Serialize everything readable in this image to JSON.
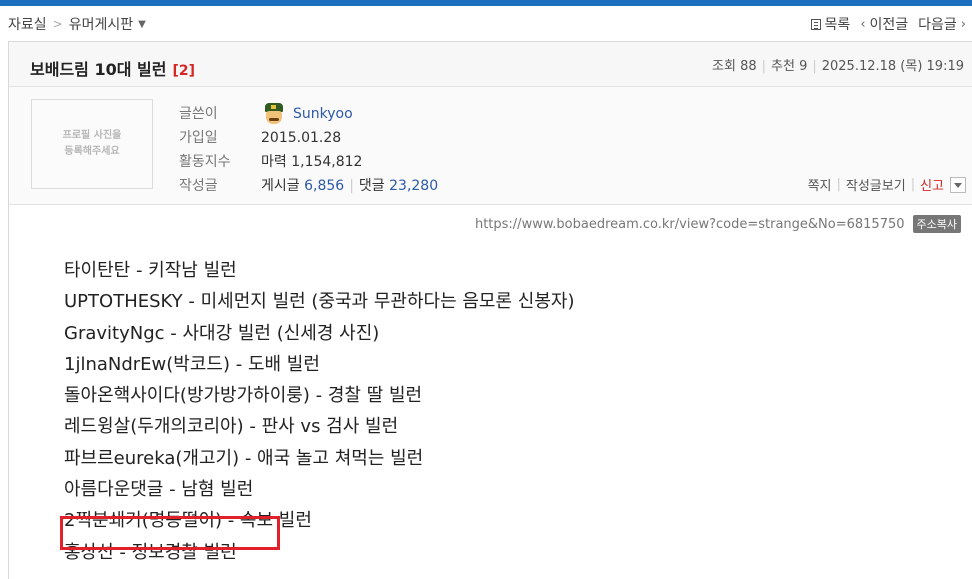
{
  "breadcrumb": {
    "section": "자료실",
    "separator": ">",
    "board": "유머게시판"
  },
  "nav": {
    "list_label": "목록",
    "prev_label": "이전글",
    "next_label": "다음글"
  },
  "post": {
    "title": "보배드림 10대 빌런",
    "comment_count": "[2]",
    "views_label": "조회",
    "views": "88",
    "recommend_label": "추천",
    "recommend": "9",
    "date": "2025.12.18 (목) 19:19"
  },
  "author": {
    "photo_placeholder": "프로필 사진을\n등록해주세요",
    "labels": {
      "writer": "글쓴이",
      "joined": "가입일",
      "activity": "활동지수",
      "posts": "작성글"
    },
    "nickname": "Sunkyoo",
    "joined_date": "2015.01.28",
    "activity_value": "마력 1,154,812",
    "posts_label": "게시글",
    "posts_count": "6,856",
    "comments_label": "댓글",
    "comments_count": "23,280",
    "avatar_icon": "soldier-avatar-icon"
  },
  "tools": {
    "message": "쪽지",
    "view_posts": "작성글보기",
    "report": "신고"
  },
  "url": {
    "text": "https://www.bobaedream.co.kr/view?code=strange&No=6815750",
    "copy_label": "주소복사"
  },
  "content": {
    "lines": [
      "타이탄탄 - 키작남 빌런",
      "UPTOTHESKY - 미세먼지 빌런 (중국과 무관하다는 음모론 신봉자)",
      "GravityNgc - 사대강 빌런 (신세경 사진)",
      "1jlnaNdrEw(박코드) - 도배 빌런",
      "돌아온핵사이다(방가방가하이룽) - 경찰 딸 빌런",
      "레드윙살(두개의코리아) - 판사 vs 검사 빌런",
      "파브르eureka(개고기) - 애국 놀고 쳐먹는 빌런",
      "아름다운댓글 - 남혐 빌런",
      "2찍분쇄기(명동떨이) - 속보 빌런",
      "홍상선 - 정보경찰 빌런"
    ]
  },
  "colors": {
    "accent_bar": "#1a6fbf",
    "report": "#d62626",
    "highlight": "#e2202a",
    "link": "#2d5aa6"
  }
}
